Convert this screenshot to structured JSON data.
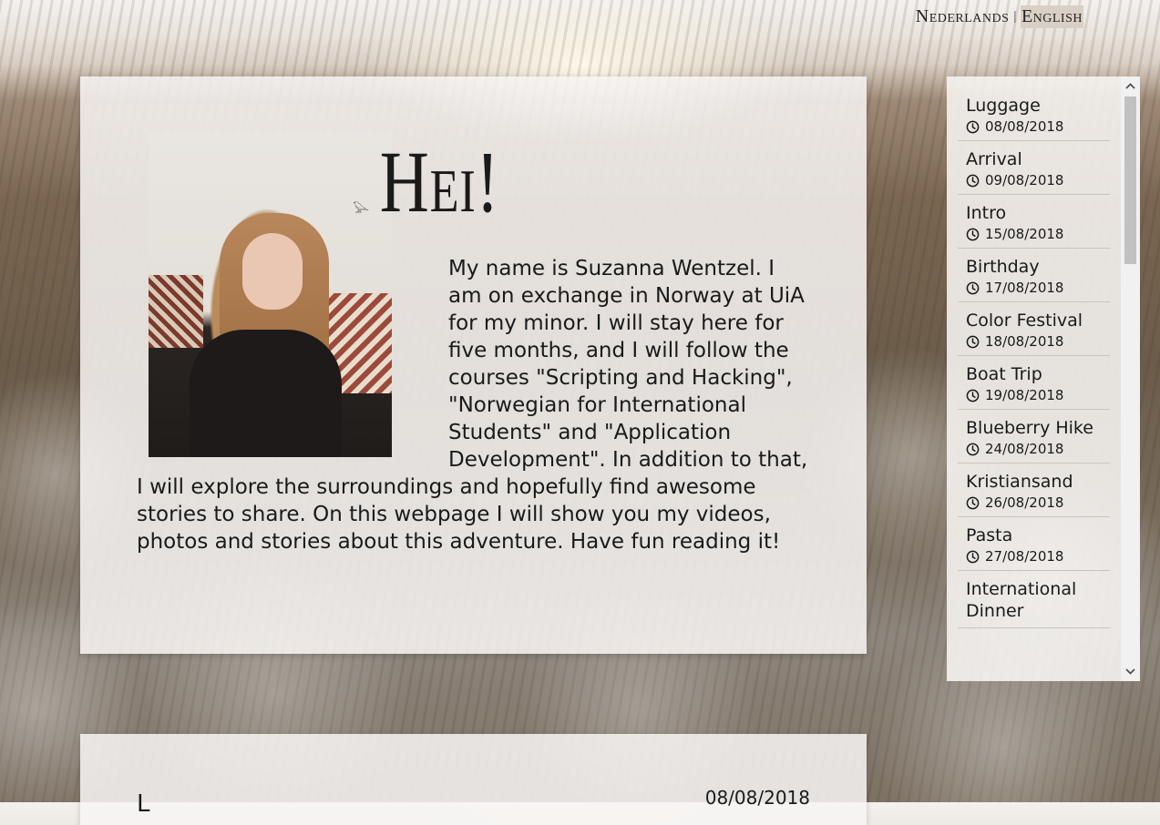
{
  "language_switch": {
    "dutch": "Nederlands",
    "separator": "|",
    "english": "English",
    "active": "English"
  },
  "intro": {
    "greeting": "Hei!",
    "body": "My name is Suzanna Wentzel. I am on exchange in Norway at UiA for my minor. I will stay here for five months, and I will follow the courses \"Scripting and Hacking\", \"Norwegian for International Students\" and \"Application Development\". In addition to that, I will explore the surroundings and hopefully find awesome stories to share. On this webpage I will show you my videos, photos and stories about this adventure. Have fun reading it!"
  },
  "first_post": {
    "title": "L",
    "date": "08/08/2018"
  },
  "sidebar": {
    "items": [
      {
        "title": "Luggage",
        "date": "08/08/2018"
      },
      {
        "title": "Arrival",
        "date": "09/08/2018"
      },
      {
        "title": "Intro",
        "date": "15/08/2018"
      },
      {
        "title": "Birthday",
        "date": "17/08/2018"
      },
      {
        "title": "Color Festival",
        "date": "18/08/2018"
      },
      {
        "title": "Boat Trip",
        "date": "19/08/2018"
      },
      {
        "title": "Blueberry Hike",
        "date": "24/08/2018"
      },
      {
        "title": "Kristiansand",
        "date": "26/08/2018"
      },
      {
        "title": "Pasta",
        "date": "27/08/2018"
      },
      {
        "title": "International Dinner",
        "date": ""
      }
    ]
  },
  "icons": {
    "clock": "clock-icon",
    "scroll_up": "chevron-up-icon",
    "scroll_down": "chevron-down-icon"
  }
}
